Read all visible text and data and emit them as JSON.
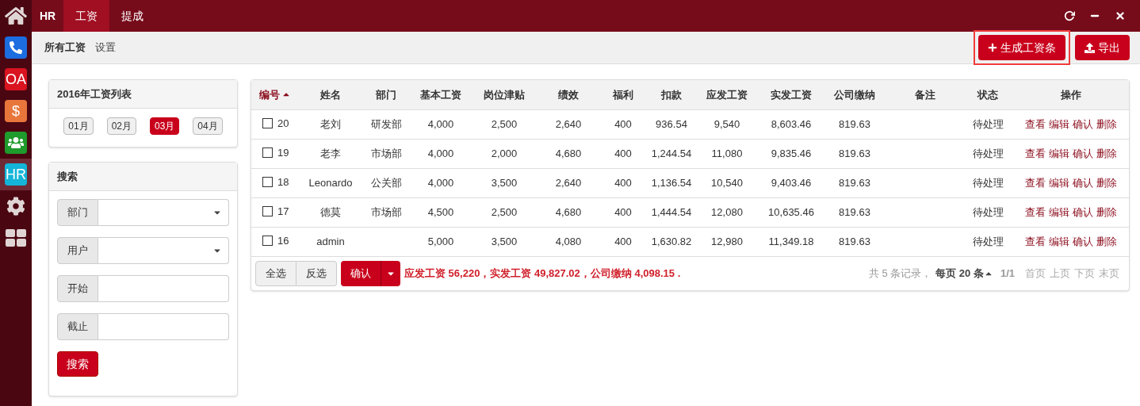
{
  "sidebar": {
    "items": [
      {
        "kind": "home",
        "selected": false
      },
      {
        "kind": "phone",
        "selected": false
      },
      {
        "kind": "text",
        "label": "OA",
        "color": "#d9131f",
        "selected": false
      },
      {
        "kind": "text",
        "label": "$",
        "color": "#e8763b",
        "selected": false
      },
      {
        "kind": "users",
        "selected": false
      },
      {
        "kind": "text",
        "label": "HR",
        "color": "#13b5d8",
        "selected": true
      },
      {
        "kind": "gear",
        "selected": false
      },
      {
        "kind": "grid",
        "selected": false
      }
    ]
  },
  "topbar": {
    "brand": "HR",
    "tabs": [
      {
        "label": "工资",
        "selected": true
      },
      {
        "label": "提成",
        "selected": false
      }
    ]
  },
  "subnav": {
    "items": [
      {
        "label": "所有工资",
        "selected": true
      },
      {
        "label": "设置",
        "selected": false
      }
    ]
  },
  "actions": [
    {
      "kind": "add",
      "label": "生成工资条",
      "highlighted": true
    },
    {
      "kind": "export",
      "label": "导出",
      "highlighted": false
    }
  ],
  "months_panel": {
    "title": "2016年工资列表",
    "months": [
      {
        "label": "01月",
        "selected": false
      },
      {
        "label": "02月",
        "selected": false
      },
      {
        "label": "03月",
        "selected": true
      },
      {
        "label": "04月",
        "selected": false
      }
    ]
  },
  "search_panel": {
    "title": "搜索",
    "fields": [
      {
        "kind": "select",
        "label": "部门"
      },
      {
        "kind": "select",
        "label": "用户"
      },
      {
        "kind": "text",
        "label": "开始"
      },
      {
        "kind": "text",
        "label": "截止"
      }
    ],
    "button": "搜索"
  },
  "table": {
    "columns": [
      "编号",
      "姓名",
      "部门",
      "基本工资",
      "岗位津贴",
      "绩效",
      "福利",
      "扣款",
      "应发工资",
      "实发工资",
      "公司缴纳",
      "备注",
      "状态",
      "操作"
    ],
    "rows": [
      {
        "checked": false,
        "cells": [
          "20",
          "老刘",
          "研发部",
          "4,000",
          "2,500",
          "2,640",
          "400",
          "936.54",
          "9,540",
          "8,603.46",
          "819.63",
          "",
          "待处理"
        ],
        "actions": [
          "查看",
          "编辑",
          "确认",
          "删除"
        ]
      },
      {
        "checked": false,
        "cells": [
          "19",
          "老李",
          "市场部",
          "4,000",
          "2,000",
          "4,680",
          "400",
          "1,244.54",
          "11,080",
          "9,835.46",
          "819.63",
          "",
          "待处理"
        ],
        "actions": [
          "查看",
          "编辑",
          "确认",
          "删除"
        ]
      },
      {
        "checked": false,
        "cells": [
          "18",
          "Leonardo",
          "公关部",
          "4,000",
          "3,500",
          "2,640",
          "400",
          "1,136.54",
          "10,540",
          "9,403.46",
          "819.63",
          "",
          "待处理"
        ],
        "actions": [
          "查看",
          "编辑",
          "确认",
          "删除"
        ]
      },
      {
        "checked": false,
        "cells": [
          "17",
          "德莫",
          "市场部",
          "4,500",
          "2,500",
          "4,680",
          "400",
          "1,444.54",
          "12,080",
          "10,635.46",
          "819.63",
          "",
          "待处理"
        ],
        "actions": [
          "查看",
          "编辑",
          "确认",
          "删除"
        ]
      },
      {
        "checked": false,
        "cells": [
          "16",
          "admin",
          "",
          "5,000",
          "3,500",
          "4,080",
          "400",
          "1,630.82",
          "12,980",
          "11,349.18",
          "819.63",
          "",
          "待处理"
        ],
        "actions": [
          "查看",
          "编辑",
          "确认",
          "删除"
        ]
      }
    ],
    "footer": {
      "buttons": [
        "全选",
        "反选"
      ],
      "confirm": "确认",
      "summary": "应发工资 56,220，实发工资 49,827.02，公司缴纳 4,098.15 .",
      "pager": {
        "records": "共 5 条记录，",
        "per_page": "每页 20 条",
        "pages": "1/1",
        "links": [
          "首页",
          "上页",
          "下页",
          "末页"
        ]
      }
    }
  }
}
